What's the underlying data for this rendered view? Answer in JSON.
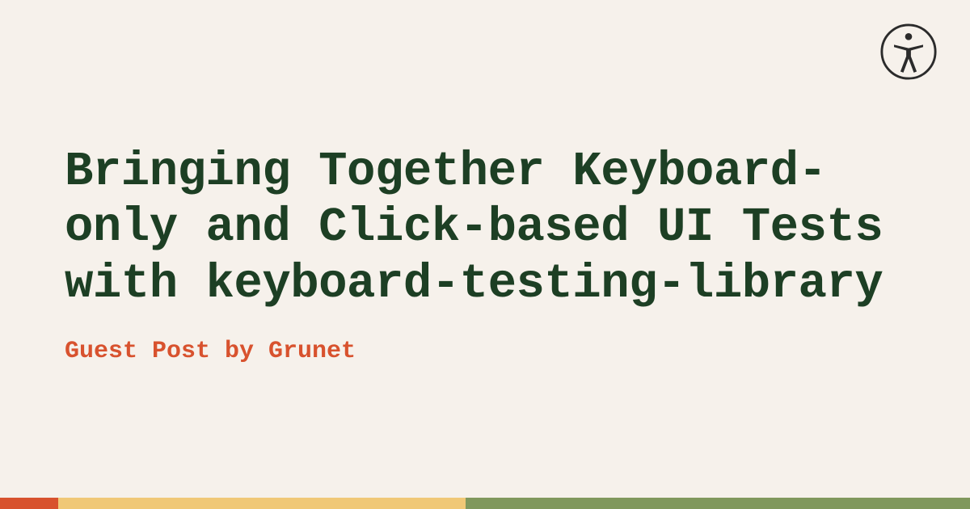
{
  "title": "Bringing Together Keyboard-only and Click-based UI Tests with keyboard-testing-library",
  "subtitle": "Guest Post by Grunet",
  "colors": {
    "background": "#f6f1eb",
    "title": "#1d3f24",
    "subtitle": "#d8522e",
    "stripe1": "#d8522e",
    "stripe2": "#f0c877",
    "stripe3": "#80985d"
  }
}
